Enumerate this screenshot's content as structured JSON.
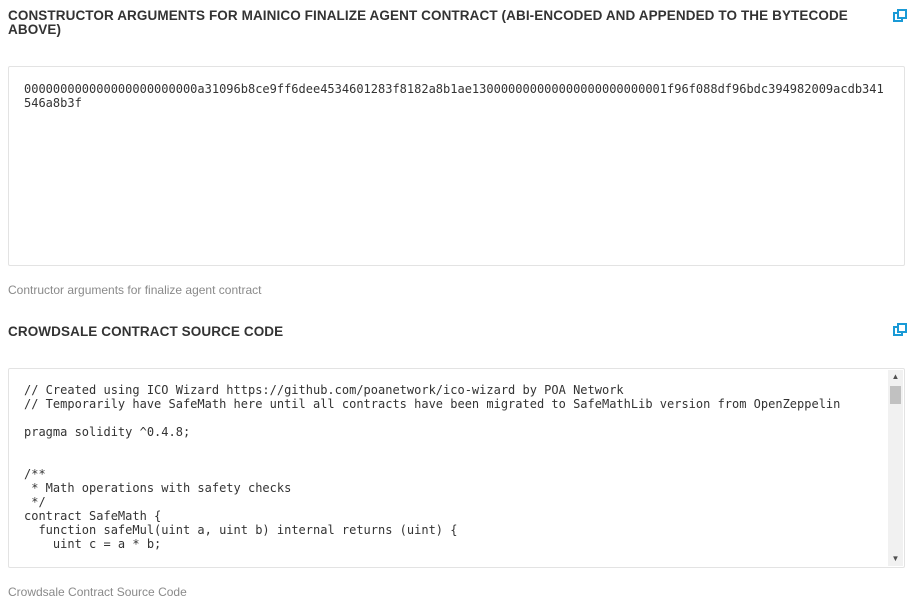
{
  "constructor_section": {
    "title": "CONSTRUCTOR ARGUMENTS FOR MAINICO FINALIZE AGENT CONTRACT (ABI-ENCODED AND APPENDED TO THE BYTECODE ABOVE)",
    "value": "000000000000000000000000a31096b8ce9ff6dee4534601283f8182a8b1ae130000000000000000000000001f96f088df96bdc394982009acdb341546a8b3f",
    "hint": "Contructor arguments for finalize agent contract",
    "copy_icon": "copy-icon"
  },
  "source_section": {
    "title": "CROWDSALE CONTRACT SOURCE CODE",
    "code": "// Created using ICO Wizard https://github.com/poanetwork/ico-wizard by POA Network\n// Temporarily have SafeMath here until all contracts have been migrated to SafeMathLib version from OpenZeppelin\n\npragma solidity ^0.4.8;\n\n\n/**\n * Math operations with safety checks\n */\ncontract SafeMath {\n  function safeMul(uint a, uint b) internal returns (uint) {\n    uint c = a * b;",
    "hint": "Crowdsale Contract Source Code",
    "copy_icon": "copy-icon"
  },
  "colors": {
    "accent": "#1a9ad6",
    "title": "#333333",
    "hint": "#8a8a8a"
  }
}
